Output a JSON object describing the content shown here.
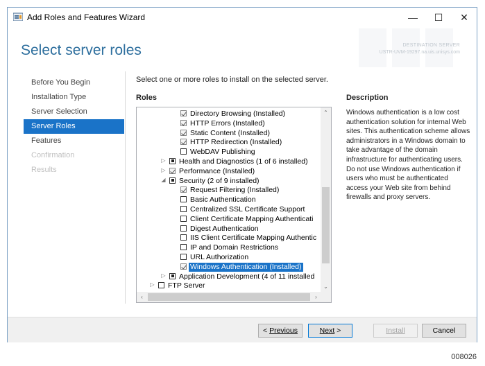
{
  "window": {
    "title": "Add Roles and Features Wizard",
    "minimize": "—",
    "maximize": "☐",
    "close": "✕"
  },
  "header": {
    "page_title": "Select server roles",
    "destination_label": "DESTINATION SERVER",
    "destination_value": "USTR-UVM-19297.na.uis.unisys.com"
  },
  "nav": {
    "items": [
      {
        "label": "Before You Begin",
        "state": "normal"
      },
      {
        "label": "Installation Type",
        "state": "normal"
      },
      {
        "label": "Server Selection",
        "state": "normal"
      },
      {
        "label": "Server Roles",
        "state": "active"
      },
      {
        "label": "Features",
        "state": "normal"
      },
      {
        "label": "Confirmation",
        "state": "disabled"
      },
      {
        "label": "Results",
        "state": "disabled"
      }
    ]
  },
  "main": {
    "instruction": "Select one or more roles to install on the selected server.",
    "roles_label": "Roles",
    "description_label": "Description",
    "description_text": "Windows authentication is a low cost authentication solution for internal Web sites. This authentication scheme allows administrators in a Windows domain to take advantage of the domain infrastructure for authenticating users. Do not use Windows authentication if users who must be authenticated access your Web site from behind firewalls and proxy servers."
  },
  "roles_tree": [
    {
      "label": "Directory Browsing (Installed)",
      "state": "checked",
      "level": 4,
      "expander": ""
    },
    {
      "label": "HTTP Errors (Installed)",
      "state": "checked",
      "level": 4,
      "expander": ""
    },
    {
      "label": "Static Content (Installed)",
      "state": "checked",
      "level": 4,
      "expander": ""
    },
    {
      "label": "HTTP Redirection (Installed)",
      "state": "checked",
      "level": 4,
      "expander": ""
    },
    {
      "label": "WebDAV Publishing",
      "state": "unchecked",
      "level": 4,
      "expander": ""
    },
    {
      "label": "Health and Diagnostics (1 of 6 installed)",
      "state": "partial",
      "level": 3,
      "expander": "▷"
    },
    {
      "label": "Performance (Installed)",
      "state": "checked",
      "level": 3,
      "expander": "▷"
    },
    {
      "label": "Security (2 of 9 installed)",
      "state": "partial",
      "level": 3,
      "expander": "◢"
    },
    {
      "label": "Request Filtering (Installed)",
      "state": "checked",
      "level": 4,
      "expander": ""
    },
    {
      "label": "Basic Authentication",
      "state": "unchecked",
      "level": 4,
      "expander": ""
    },
    {
      "label": "Centralized SSL Certificate Support",
      "state": "unchecked",
      "level": 4,
      "expander": ""
    },
    {
      "label": "Client Certificate Mapping Authenticati",
      "state": "unchecked",
      "level": 4,
      "expander": ""
    },
    {
      "label": "Digest Authentication",
      "state": "unchecked",
      "level": 4,
      "expander": ""
    },
    {
      "label": "IIS Client Certificate Mapping Authentic",
      "state": "unchecked",
      "level": 4,
      "expander": ""
    },
    {
      "label": "IP and Domain Restrictions",
      "state": "unchecked",
      "level": 4,
      "expander": ""
    },
    {
      "label": "URL Authorization",
      "state": "unchecked",
      "level": 4,
      "expander": ""
    },
    {
      "label": "Windows Authentication (Installed)",
      "state": "checked",
      "level": 4,
      "expander": "",
      "selected": true
    },
    {
      "label": "Application Development (4 of 11 installed",
      "state": "partial",
      "level": 3,
      "expander": "▷"
    },
    {
      "label": "FTP Server",
      "state": "unchecked",
      "level": 2,
      "expander": "▷"
    }
  ],
  "footer": {
    "previous_prefix": "< ",
    "previous_label": "Previous",
    "next_label": "Next",
    "next_suffix": " >",
    "install_label": "Install",
    "cancel_label": "Cancel"
  },
  "figure_code": "008026"
}
